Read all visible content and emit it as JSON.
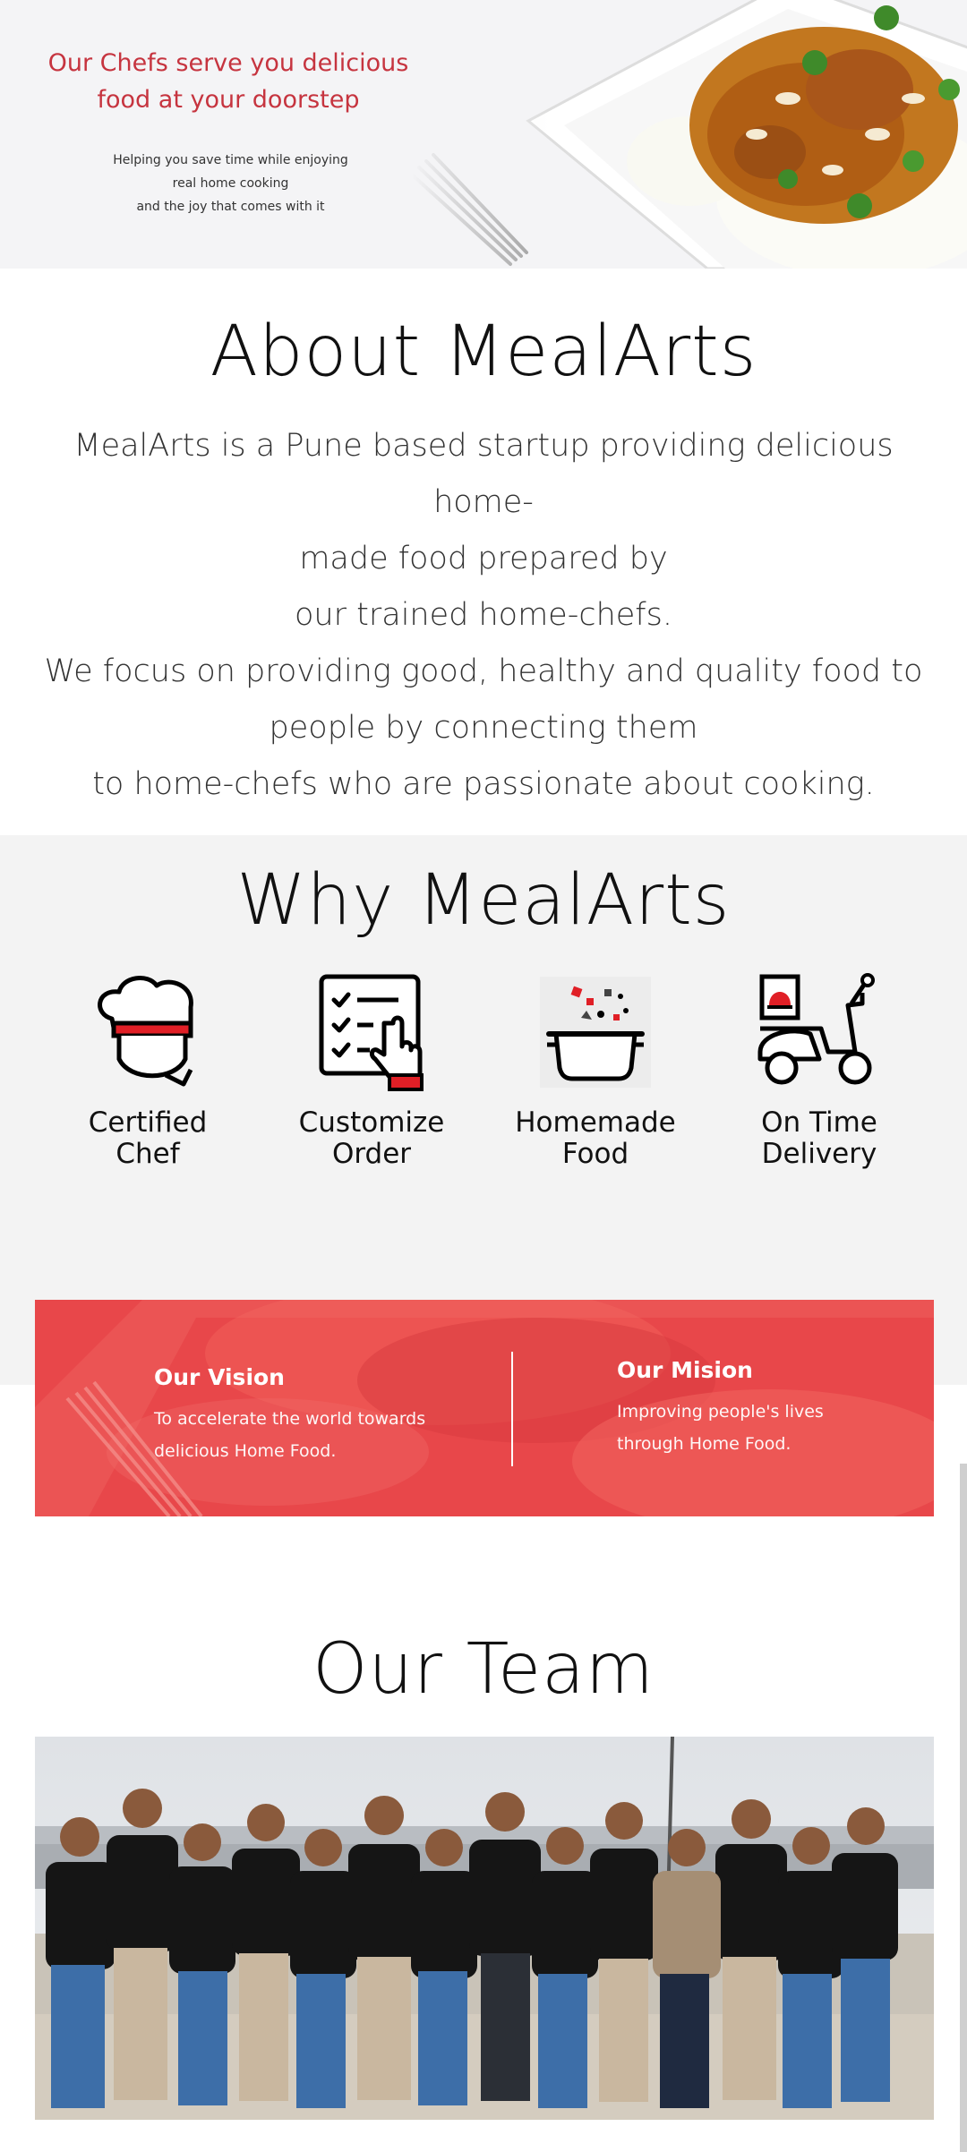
{
  "hero": {
    "headline_line1": "Our Chefs serve you delicious",
    "headline_line2": "food at your doorstep",
    "sub_line1": "Helping you save time while enjoying",
    "sub_line2": "real home cooking",
    "sub_line3": "and the joy that comes with it"
  },
  "about": {
    "title": "About MealArts",
    "lines": [
      "MealArts is a Pune based startup providing delicious home-",
      "made food prepared by",
      "our trained home-chefs.",
      "We focus on providing good, healthy and quality food to",
      "people by connecting them",
      "to home-chefs who are passionate about cooking."
    ]
  },
  "why": {
    "title": "Why MealArts",
    "features": [
      {
        "icon": "chef-hat-icon",
        "line1": "Certified",
        "line2": "Chef"
      },
      {
        "icon": "checklist-icon",
        "line1": "Customize",
        "line2": "Order"
      },
      {
        "icon": "cooking-pot-icon",
        "line1": "Homemade",
        "line2": "Food"
      },
      {
        "icon": "delivery-scooter-icon",
        "line1": "On Time",
        "line2": "Delivery"
      }
    ]
  },
  "vision": {
    "title": "Our Vision",
    "text_line1": "To accelerate the world towards",
    "text_line2": "delicious Home Food."
  },
  "mission": {
    "title": "Our Mision",
    "text_line1": "Improving people's lives",
    "text_line2": "through Home Food."
  },
  "team": {
    "title": "Our Team"
  },
  "colors": {
    "accent": "#c6343f",
    "banner": "#e8474a",
    "section_gray": "#f3f3f3"
  }
}
